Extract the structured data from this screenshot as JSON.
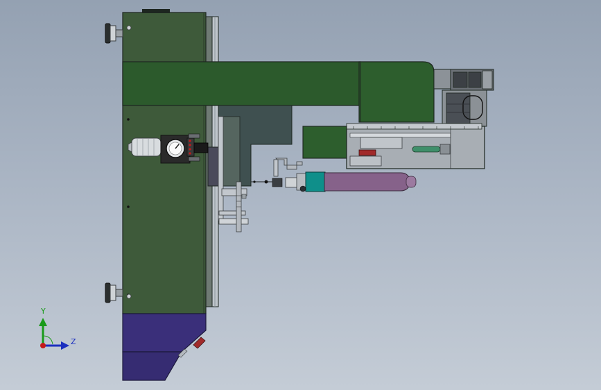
{
  "viewport": {
    "background_top": "#94a1b2",
    "background_bottom": "#c4ccd6"
  },
  "colors": {
    "frame_green": "#3e5a3a",
    "beam_green": "#2c5a2c",
    "dark_slate": "#3f5050",
    "hopper_purple": "#3a2f7a",
    "cylinder_purple": "#86628a",
    "teal": "#0f8f8a",
    "steel": "#c9ced4",
    "steel_dark": "#7d858e",
    "outline": "#1d2620"
  },
  "triad": {
    "y_label": "Y",
    "z_label": "Z",
    "y_color": "#1a9a1a",
    "z_color": "#1b2fbf",
    "origin_color": "#c41a1a"
  }
}
